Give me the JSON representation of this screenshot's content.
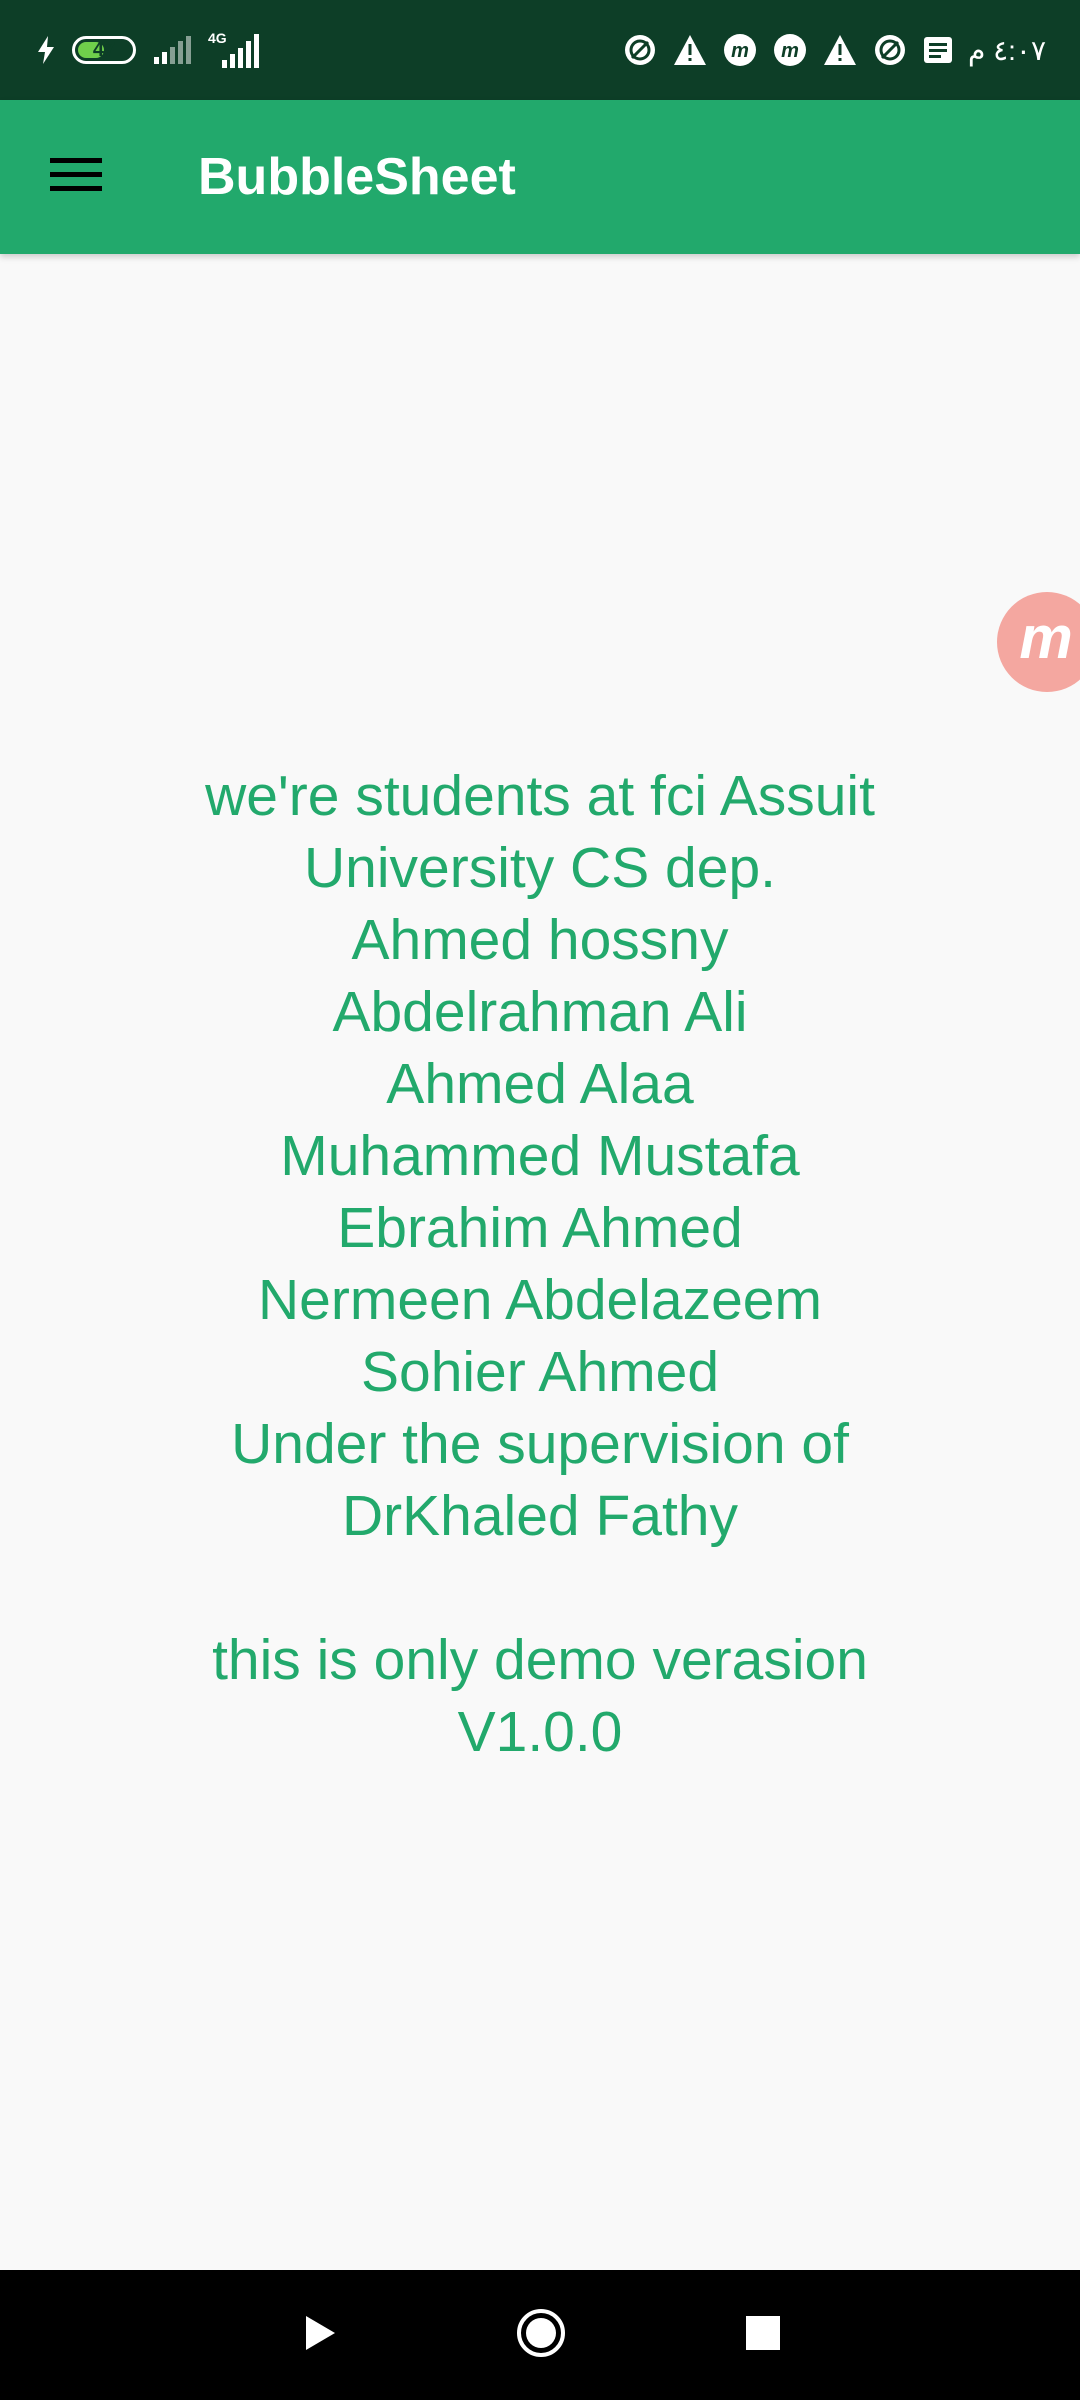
{
  "status_bar": {
    "battery_level": "47",
    "network_type": "4G",
    "time": "٤:٠٧ م",
    "icons": [
      "charging-icon",
      "battery-icon",
      "signal-icon",
      "signal-4g-icon",
      "sync-icon",
      "warning-icon",
      "app-m-icon",
      "app-m-icon",
      "warning-icon",
      "sync-icon",
      "message-icon"
    ]
  },
  "app_bar": {
    "title": "BubbleSheet",
    "menu_icon": "hamburger-menu-icon",
    "background_color": "#22a96c"
  },
  "content": {
    "text_color": "#22a96c",
    "lines": [
      "we're students at fci Assuit",
      "University CS dep.",
      "Ahmed hossny",
      "Abdelrahman Ali",
      "Ahmed Alaa",
      "Muhammed Mustafa",
      "Ebrahim Ahmed",
      "Nermeen Abdelazeem",
      "Sohier Ahmed",
      "Under the supervision of",
      "DrKhaled Fathy"
    ],
    "version_lines": [
      "this is only demo verasion",
      "V1.0.0"
    ]
  },
  "floating_bubble": {
    "icon": "app-m-icon",
    "color": "#f4a7a0"
  },
  "nav_bar": {
    "buttons": [
      "back-icon",
      "home-icon",
      "recents-icon"
    ]
  }
}
